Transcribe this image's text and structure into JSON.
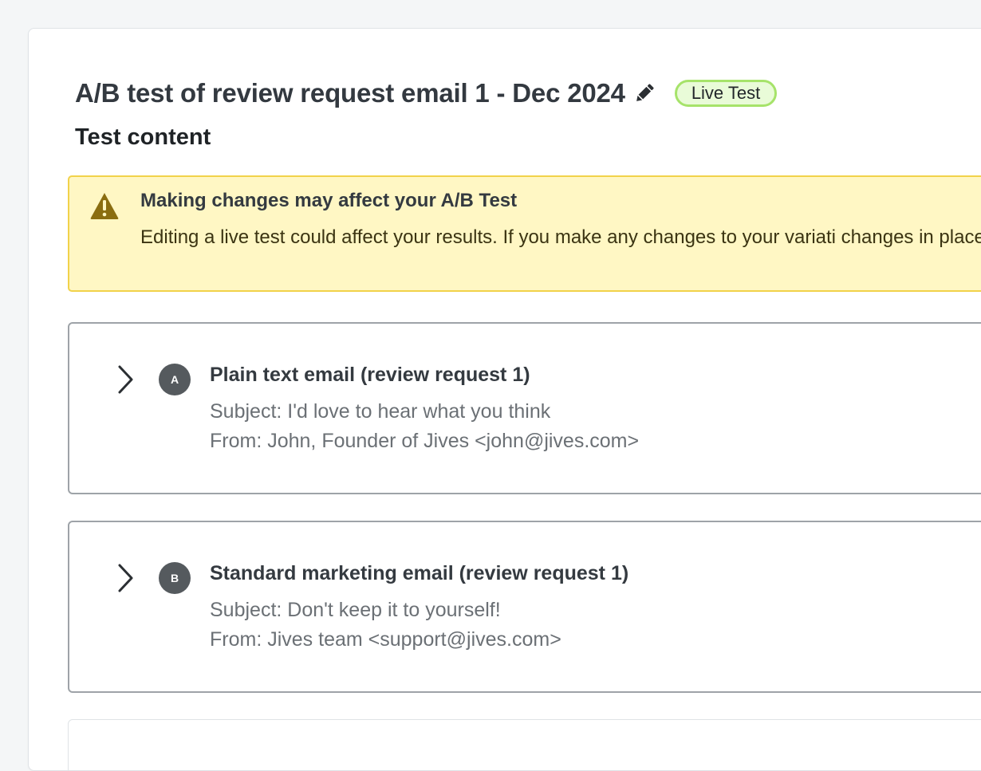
{
  "header": {
    "title": "A/B test of review request email 1 - Dec 2024",
    "edit_icon": "pencil-icon",
    "status_badge": "Live Test"
  },
  "section": {
    "title": "Test content"
  },
  "warning": {
    "icon": "warning-triangle-icon",
    "title": "Making changes may affect your A/B Test",
    "body": "Editing a live test could affect your results. If you make any changes to your variati changes in place."
  },
  "variants": [
    {
      "letter": "A",
      "name": "Plain text email (review request 1)",
      "subject": "Subject: I'd love to hear what you think",
      "from": "From: John, Founder of Jives <john@jives.com>"
    },
    {
      "letter": "B",
      "name": "Standard marketing email (review request 1)",
      "subject": "Subject: Don't keep it to yourself!",
      "from": "From: Jives team <support@jives.com>"
    }
  ],
  "colors": {
    "badge_border": "#a6e36a",
    "badge_background": "#e9fbd8",
    "warning_background": "#fff7c4",
    "warning_border": "#f1d24a",
    "warning_icon": "#8a6d10",
    "avatar": "#555a5e"
  }
}
